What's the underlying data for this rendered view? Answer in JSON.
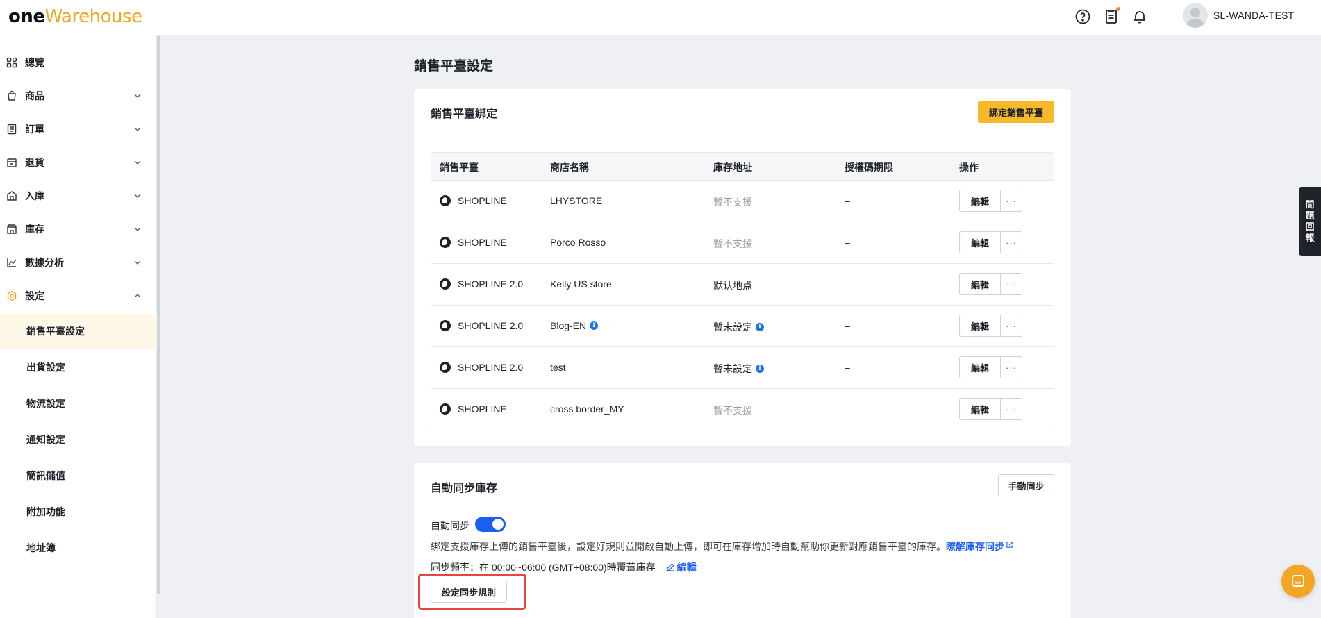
{
  "header": {
    "logo_one": "one",
    "logo_warehouse": "Warehouse",
    "username": "SL-WANDA-TEST",
    "icons": [
      "help-circle-icon",
      "clipboard-icon",
      "bell-icon"
    ],
    "accent_color": "#f5a524"
  },
  "sidebar": {
    "items": [
      {
        "label": "總覽",
        "icon": "grid-icon"
      },
      {
        "label": "商品",
        "icon": "bag-icon"
      },
      {
        "label": "訂單",
        "icon": "receipt-icon"
      },
      {
        "label": "退貨",
        "icon": "return-icon"
      },
      {
        "label": "入庫",
        "icon": "inbound-icon"
      },
      {
        "label": "庫存",
        "icon": "store-icon"
      },
      {
        "label": "數據分析",
        "icon": "chart-icon"
      },
      {
        "label": "設定",
        "icon": "settings-hex-icon"
      }
    ],
    "sub_items": [
      {
        "label": "銷售平臺設定",
        "active": true
      },
      {
        "label": "出貨設定"
      },
      {
        "label": "物流設定"
      },
      {
        "label": "通知設定"
      },
      {
        "label": "簡訊儲值"
      },
      {
        "label": "附加功能"
      },
      {
        "label": "地址簿"
      }
    ]
  },
  "page": {
    "title": "銷售平臺設定"
  },
  "binding_card": {
    "title": "銷售平臺綁定",
    "bind_button": "綁定銷售平臺",
    "columns": [
      "銷售平臺",
      "商店名稱",
      "庫存地址",
      "授權碼期限",
      "操作"
    ],
    "rows": [
      {
        "platform": "SHOPLINE",
        "store": "LHYSTORE",
        "store_info": false,
        "address": "暫不支援",
        "address_muted": true,
        "address_info": false,
        "expiry": "–",
        "edit": "編輯",
        "more": "···"
      },
      {
        "platform": "SHOPLINE",
        "store": "Porco Rosso",
        "store_info": false,
        "address": "暫不支援",
        "address_muted": true,
        "address_info": false,
        "expiry": "–",
        "edit": "編輯",
        "more": "···"
      },
      {
        "platform": "SHOPLINE 2.0",
        "store": "Kelly US store",
        "store_info": false,
        "address": "默认地点",
        "address_muted": false,
        "address_info": false,
        "expiry": "–",
        "edit": "編輯",
        "more": "···"
      },
      {
        "platform": "SHOPLINE 2.0",
        "store": "Blog-EN",
        "store_info": true,
        "address": "暫未設定",
        "address_muted": false,
        "address_info": true,
        "expiry": "–",
        "edit": "編輯",
        "more": "···"
      },
      {
        "platform": "SHOPLINE 2.0",
        "store": "test",
        "store_info": false,
        "address": "暫未設定",
        "address_muted": false,
        "address_info": true,
        "expiry": "–",
        "edit": "編輯",
        "more": "···"
      },
      {
        "platform": "SHOPLINE",
        "store": "cross border_MY",
        "store_info": false,
        "address": "暫不支援",
        "address_muted": true,
        "address_info": false,
        "expiry": "–",
        "edit": "編輯",
        "more": "···"
      }
    ]
  },
  "sync_card": {
    "title": "自動同步庫存",
    "manual_sync_button": "手動同步",
    "auto_sync_label": "自動同步",
    "auto_sync_on": true,
    "description": "綁定支援庫存上傳的銷售平臺後，設定好規則並開啟自動上傳，即可在庫存增加時自動幫助你更新對應銷售平臺的庫存。",
    "learn_more_link": "瞭解庫存同步",
    "frequency_text": "同步頻率：在 00:00~06:00 (GMT+08:00)時覆蓋庫存",
    "frequency_edit": "編輯",
    "rules_button": "設定同步規則"
  },
  "feedback_tab": "問題回報"
}
